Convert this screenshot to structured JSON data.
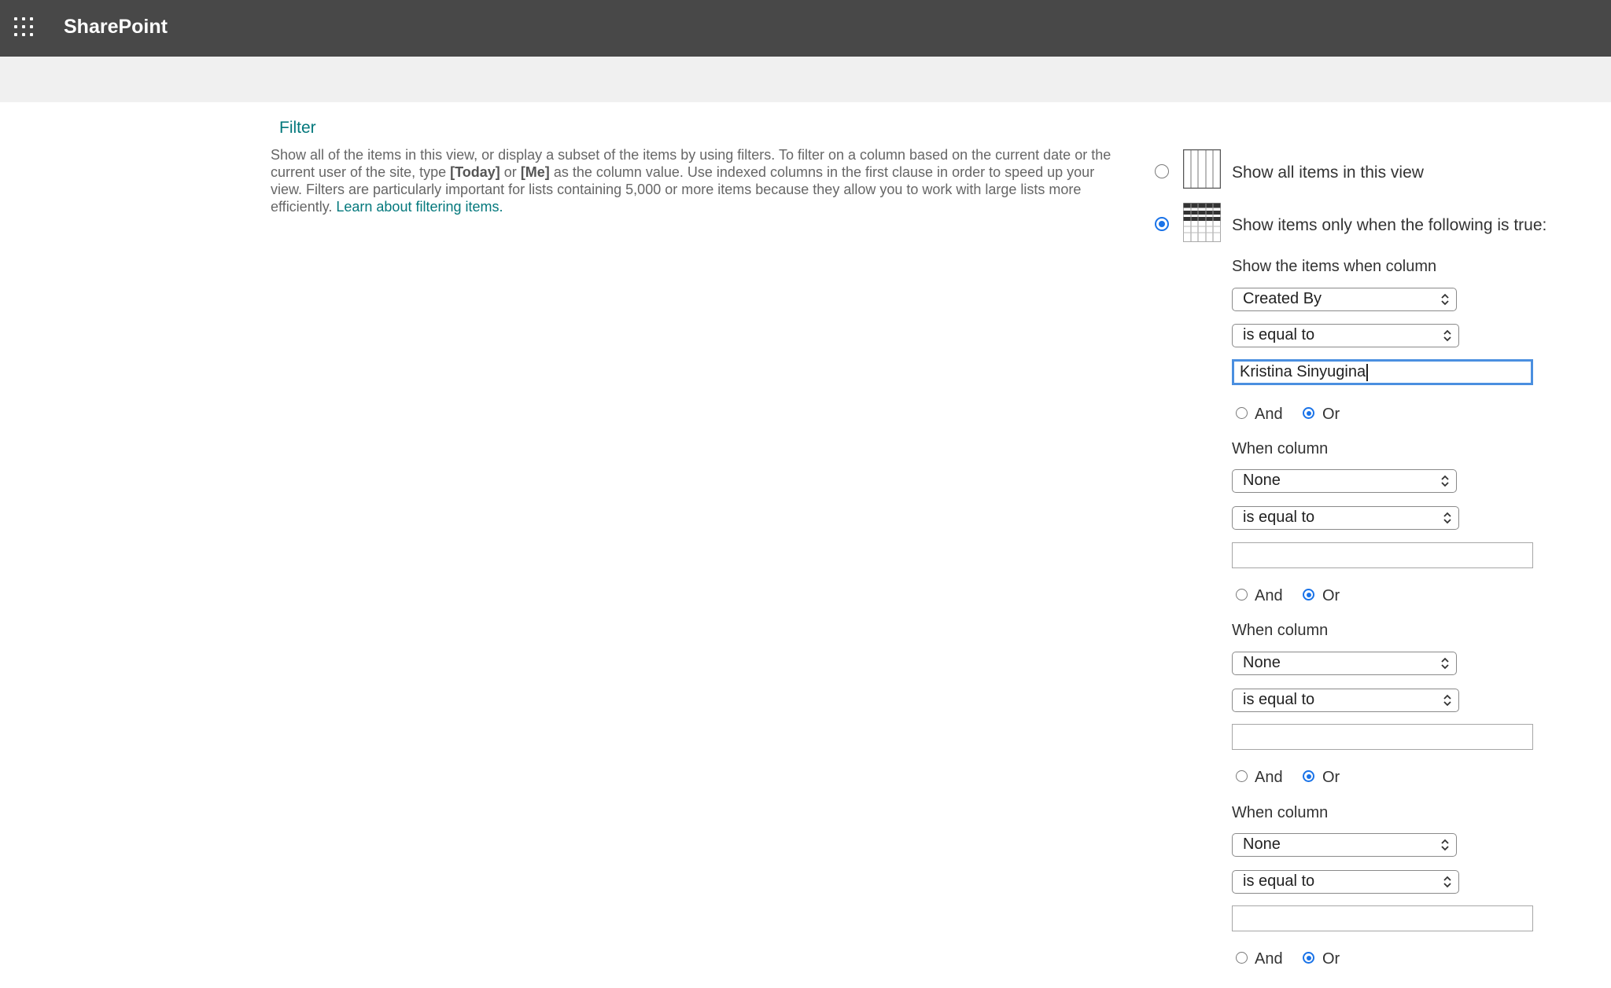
{
  "header": {
    "app_name": "SharePoint",
    "app_launcher_icon": "waffle-grid-icon"
  },
  "filter": {
    "title": "Filter",
    "description_part1": "Show all of the items in this view, or display a subset of the items by using filters. To filter on a column based on the current date or the current user of the site, type ",
    "today_token": "[Today]",
    "description_or": " or ",
    "me_token": "[Me]",
    "description_part2": " as the column value. Use indexed columns in the first clause in order to speed up your view. Filters are particularly important for lists containing 5,000 or more items because they allow you to work with large lists more efficiently. ",
    "learn_link": "Learn about filtering items.",
    "show_all_label": "Show all items in this view",
    "show_all_selected": false,
    "show_when_label": "Show items only when the following is true:",
    "show_when_selected": true,
    "first_clause_label": "Show the items when column",
    "clauses": [
      {
        "column": "Created By",
        "operator": "is equal to",
        "value": "Kristina Sinyugina",
        "and_label": "And",
        "or_label": "Or",
        "selected": "Or"
      },
      {
        "column_label": "When column",
        "column": "None",
        "operator": "is equal to",
        "value": "",
        "and_label": "And",
        "or_label": "Or",
        "selected": "Or"
      },
      {
        "column_label": "When column",
        "column": "None",
        "operator": "is equal to",
        "value": "",
        "and_label": "And",
        "or_label": "Or",
        "selected": "Or"
      },
      {
        "column_label": "When column",
        "column": "None",
        "operator": "is equal to",
        "value": "",
        "and_label": "And",
        "or_label": "Or",
        "selected": "Or"
      }
    ]
  },
  "colors": {
    "header_bg": "#484848",
    "accent_link": "#03787c",
    "radio_selected": "#1a73e8"
  }
}
